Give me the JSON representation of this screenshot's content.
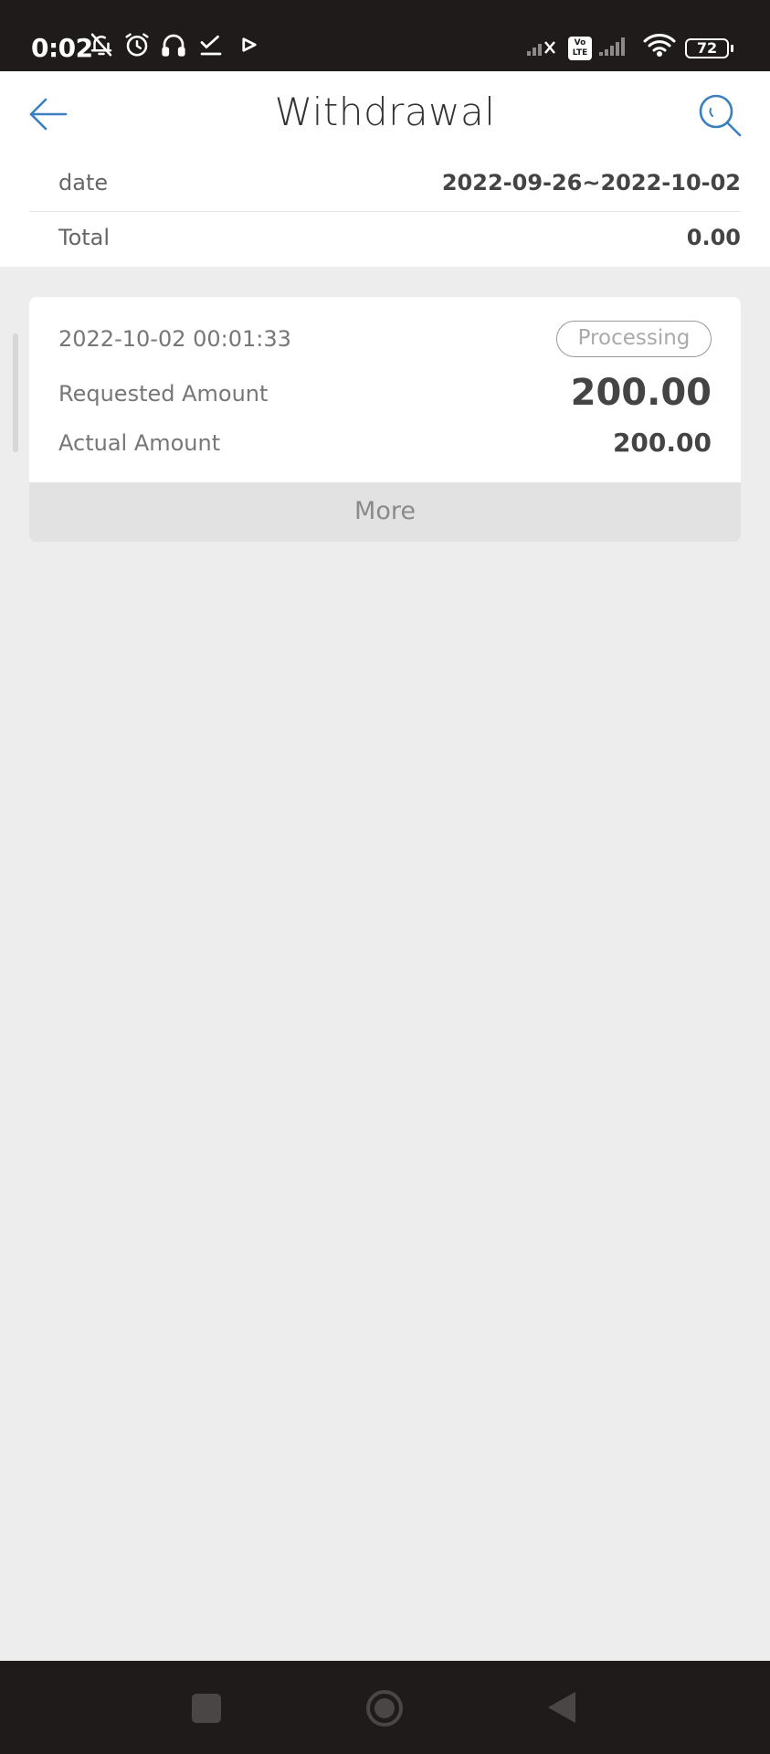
{
  "status_bar": {
    "time": "0:02",
    "volte": "Vo LTE",
    "battery": "72"
  },
  "header": {
    "title": "Withdrawal"
  },
  "summary": {
    "date_label": "date",
    "date_value": "2022-09-26~2022-10-02",
    "total_label": "Total",
    "total_value": "0.00"
  },
  "records": [
    {
      "datetime": "2022-10-02 00:01:33",
      "status": "Processing",
      "requested_label": "Requested Amount",
      "requested_amount": "200.00",
      "actual_label": "Actual Amount",
      "actual_amount": "200.00",
      "more_label": "More"
    }
  ],
  "colors": {
    "accent": "#3a7fc0",
    "background": "#ededed",
    "system_bar": "#1f1b1b"
  },
  "icons": {
    "back": "arrow-left-icon",
    "search": "search-icon"
  }
}
